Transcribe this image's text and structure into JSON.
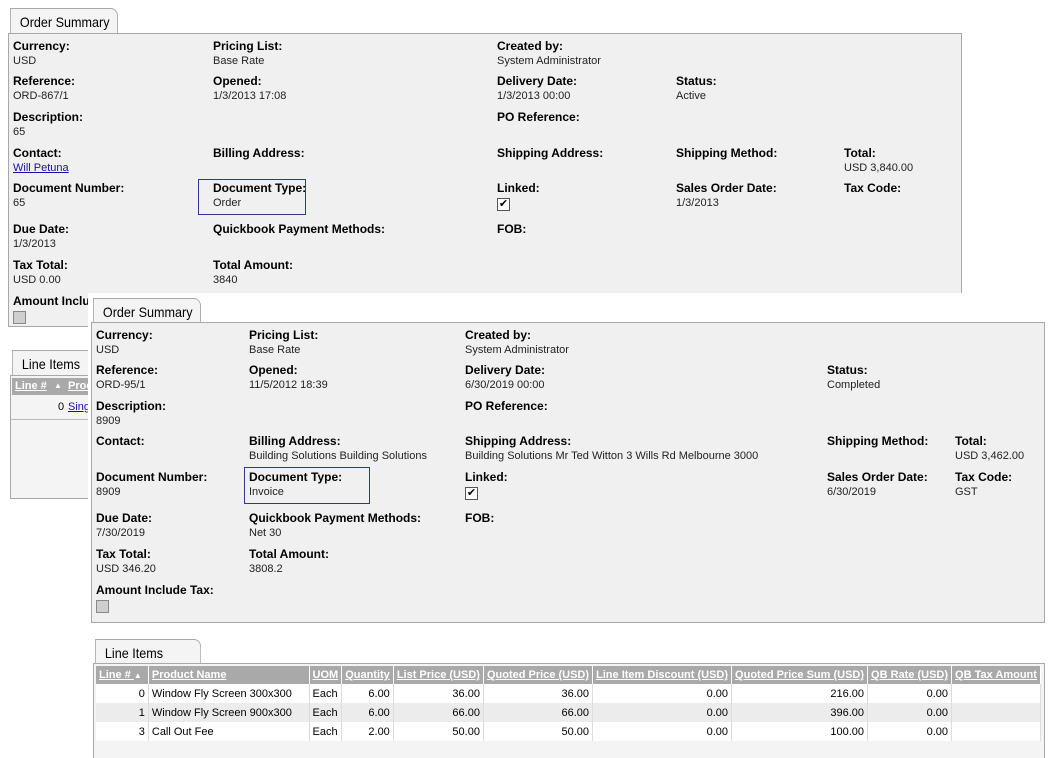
{
  "back": {
    "tab_label": "Order Summary",
    "currency_label": "Currency:",
    "currency": "USD",
    "pricing_label": "Pricing List:",
    "pricing": "Base Rate",
    "created_label": "Created by:",
    "created": "System Administrator",
    "reference_label": "Reference:",
    "reference": "ORD-867/1",
    "opened_label": "Opened:",
    "opened": "1/3/2013 17:08",
    "delivery_label": "Delivery Date:",
    "delivery": "1/3/2013 00:00",
    "status_label": "Status:",
    "status": "Active",
    "description_label": "Description:",
    "description": "65",
    "po_label": "PO Reference:",
    "contact_label": "Contact:",
    "contact": "Will Petuna",
    "billing_label": "Billing Address:",
    "shipping_label": "Shipping Address:",
    "shipping_method_label": "Shipping Method:",
    "total_label": "Total:",
    "total": "USD 3,840.00",
    "docnum_label": "Document Number:",
    "docnum": "65",
    "doctype_label": "Document Type:",
    "doctype": "Order",
    "linked_label": "Linked:",
    "linked": true,
    "sales_date_label": "Sales Order Date:",
    "sales_date": "1/3/2013",
    "taxcode_label": "Tax Code:",
    "due_label": "Due Date:",
    "due": "1/3/2013",
    "qb_label": "Quickbook Payment Methods:",
    "fob_label": "FOB:",
    "taxtotal_label": "Tax Total:",
    "taxtotal": "USD 0.00",
    "totalamount_label": "Total Amount:",
    "totalamount": "3840",
    "amount_tax_label": "Amount Include Tax:",
    "amount_tax": false,
    "line_items_tab": "Line Items",
    "col_line": "Line #",
    "col_product": "Product Name",
    "row0_line": "0",
    "row0_product": "Single"
  },
  "front": {
    "tab_label": "Order Summary",
    "currency_label": "Currency:",
    "currency": "USD",
    "pricing_label": "Pricing List:",
    "pricing": "Base Rate",
    "created_label": "Created by:",
    "created": "System Administrator",
    "reference_label": "Reference:",
    "reference": "ORD-95/1",
    "opened_label": "Opened:",
    "opened": "11/5/2012 18:39",
    "delivery_label": "Delivery Date:",
    "delivery": "6/30/2019 00:00",
    "status_label": "Status:",
    "status": "Completed",
    "description_label": "Description:",
    "description": "8909",
    "po_label": "PO Reference:",
    "contact_label": "Contact:",
    "billing_label": "Billing Address:",
    "billing": "Building Solutions Building Solutions",
    "shipping_label": "Shipping Address:",
    "shipping": "Building Solutions Mr Ted Witton 3 Wills Rd  Melbourne 3000",
    "shipping_method_label": "Shipping Method:",
    "total_label": "Total:",
    "total": "USD 3,462.00",
    "docnum_label": "Document Number:",
    "docnum": "8909",
    "doctype_label": "Document Type:",
    "doctype": "Invoice",
    "linked_label": "Linked:",
    "linked": true,
    "sales_date_label": "Sales Order Date:",
    "sales_date": "6/30/2019",
    "taxcode_label": "Tax Code:",
    "taxcode": "GST",
    "due_label": "Due Date:",
    "due": "7/30/2019",
    "qb_label": "Quickbook Payment Methods:",
    "qb": "Net 30",
    "fob_label": "FOB:",
    "taxtotal_label": "Tax Total:",
    "taxtotal": "USD 346.20",
    "totalamount_label": "Total Amount:",
    "totalamount": "3808.2",
    "amount_tax_label": "Amount Include Tax:",
    "amount_tax": false
  },
  "line_items": {
    "tab_label": "Line Items",
    "sort_indicator": "▲",
    "headers": [
      "Line #",
      "Product Name",
      "UOM",
      "Quantity",
      "List Price (USD)",
      "Quoted Price (USD)",
      "Line Item Discount (USD)",
      "Quoted Price Sum (USD)",
      "QB Rate (USD)",
      "QB Tax Amount"
    ],
    "rows": [
      [
        "0",
        "Window Fly Screen 300x300",
        "Each",
        "6.00",
        "36.00",
        "36.00",
        "0.00",
        "216.00",
        "0.00",
        ""
      ],
      [
        "1",
        "Window Fly Screen 900x300",
        "Each",
        "6.00",
        "66.00",
        "66.00",
        "0.00",
        "396.00",
        "0.00",
        ""
      ],
      [
        "3",
        "Call Out Fee",
        "Each",
        "2.00",
        "50.00",
        "50.00",
        "0.00",
        "100.00",
        "0.00",
        ""
      ]
    ]
  },
  "colors": {
    "panel_bg": "#f0f0f0",
    "header_bg": "#a9a9a9",
    "highlight_border": "#2a3a9a",
    "link": "#1a0dab"
  }
}
